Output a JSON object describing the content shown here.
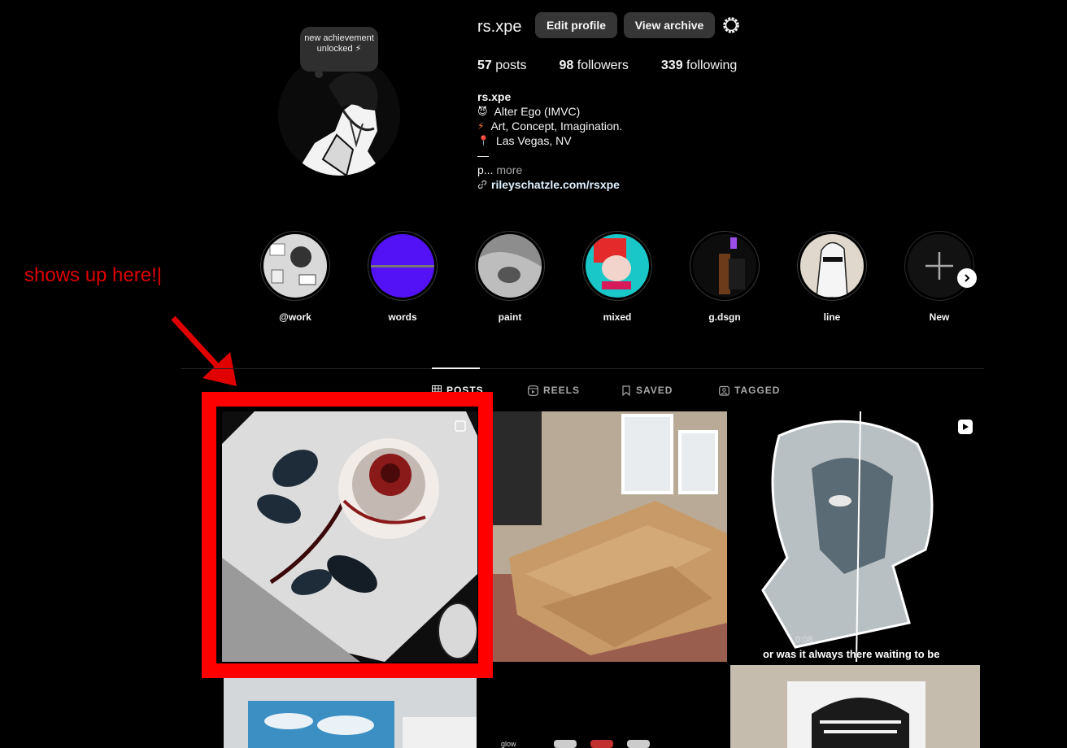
{
  "profile": {
    "username": "rs.xpe",
    "note_text": "new achievement unlocked ⚡",
    "edit_label": "Edit profile",
    "archive_label": "View archive",
    "stats": {
      "posts_count": "57",
      "posts_label": "posts",
      "followers_count": "98",
      "followers_label": "followers",
      "following_count": "339",
      "following_label": "following"
    },
    "bio": {
      "name": "rs.xpe",
      "line1_icon": "😈",
      "line1": "Alter Ego (IMVC)",
      "line2_icon": "⚡",
      "line2": "Art, Concept, Imagination.",
      "line3_icon": "📍",
      "line3": "Las Vegas, NV",
      "dash": "—",
      "truncated": "p...",
      "more_label": "more",
      "link": "rileyschatzle.com/rsxpe"
    }
  },
  "annotation": {
    "text": "shows up here!|",
    "color": "#ff0000"
  },
  "highlights": [
    {
      "label": "@work"
    },
    {
      "label": "words"
    },
    {
      "label": "paint"
    },
    {
      "label": "mixed"
    },
    {
      "label": "g.dsgn"
    },
    {
      "label": "line"
    },
    {
      "label": "New"
    }
  ],
  "tabs": [
    {
      "label": "POSTS",
      "icon": "grid-icon",
      "active": true
    },
    {
      "label": "REELS",
      "icon": "reels-icon",
      "active": false
    },
    {
      "label": "SAVED",
      "icon": "bookmark-icon",
      "active": false
    },
    {
      "label": "TAGGED",
      "icon": "tagged-icon",
      "active": false
    }
  ],
  "posts": {
    "p3_caption": "or was it always there waiting to be",
    "p3_timer": "0:08",
    "p5_text": "glow"
  }
}
